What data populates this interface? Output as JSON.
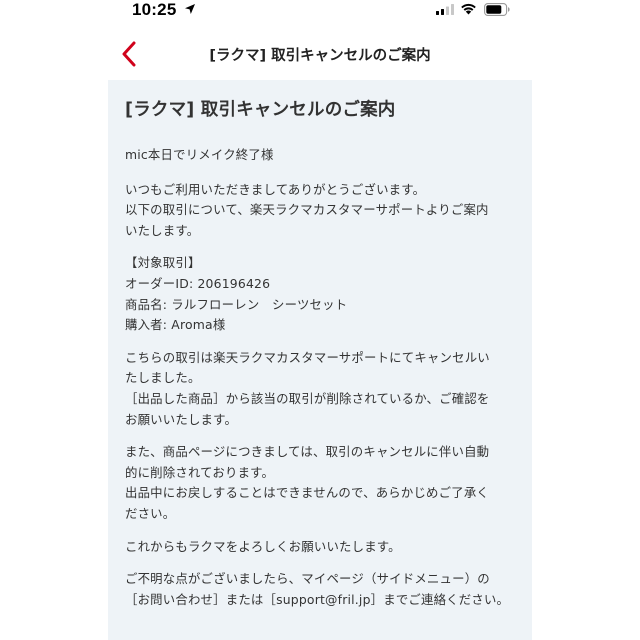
{
  "status_bar": {
    "time": "10:25"
  },
  "header": {
    "title": "[ラクマ] 取引キャンセルのご案内"
  },
  "message": {
    "title": "[ラクマ] 取引キャンセルのご案内",
    "greeting": "mic本日でリメイク終了様",
    "intro": "いつもご利用いただきましてありがとうございます。\n以下の取引について、楽天ラクマカスタマーサポートよりご案内\nいたします。",
    "target": "【対象取引】\nオーダーID: 206196426\n商品名: ラルフローレン　シーツセット\n購入者: Aroma様",
    "cancel_notice": "こちらの取引は楽天ラクマカスタマーサポートにてキャンセルい\nたしました。\n［出品した商品］から該当の取引が削除されているか、ご確認を\nお願いいたします。",
    "product_notice": "また、商品ページにつきましては、取引のキャンセルに伴い自動\n的に削除されております。\n出品中にお戻しすることはできませんので、あらかじめご了承く\nださい。",
    "closing": "これからもラクマをよろしくお願いいたします。",
    "contact": "ご不明な点がございましたら、マイページ（サイドメニュー）の\n［お問い合わせ］または［support@fril.jp］までご連絡ください。"
  },
  "colors": {
    "accent": "#d0021b",
    "content_bg": "#eef3f7"
  },
  "icons": {
    "back": "chevron-left-icon",
    "location": "location-arrow-icon",
    "signal": "cellular-signal-icon",
    "wifi": "wifi-icon",
    "battery": "battery-icon"
  }
}
